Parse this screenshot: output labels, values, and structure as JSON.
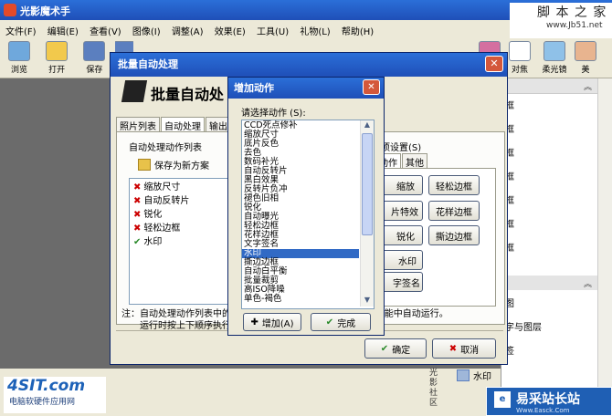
{
  "app": {
    "title": "光影魔术手",
    "watermark": "脚 本 之 家",
    "watermark_url": "www.Jb51.net",
    "menu": [
      "文件(F)",
      "编辑(E)",
      "查看(V)",
      "图像(I)",
      "调整(A)",
      "效果(E)",
      "工具(U)",
      "礼物(L)",
      "帮助(H)"
    ],
    "toolbar": [
      {
        "label": "浏览",
        "icon": "browse-icon"
      },
      {
        "label": "打开",
        "icon": "folder-icon"
      },
      {
        "label": "保存",
        "icon": "save-icon"
      },
      {
        "label": "另",
        "icon": "save-as-icon"
      }
    ],
    "toolbar_right": [
      {
        "label": "对焦",
        "icon": "focus-icon"
      },
      {
        "label": "柔光镜",
        "icon": "soft-light-icon"
      },
      {
        "label": "美",
        "icon": "beauty-icon"
      }
    ],
    "right_panel_items": [
      "框",
      "框",
      "框",
      "框",
      "框",
      "框",
      "框"
    ],
    "right_panel_lower": [
      "图",
      "字与图层",
      "签"
    ],
    "bottom_items": {
      "side_text": "光影社区",
      "watermark_item": "水印"
    }
  },
  "batch_dialog": {
    "title": "批量自动处理",
    "heading": "批量自动处",
    "tabs": [
      "照片列表",
      "自动处理",
      "输出"
    ],
    "list_title": "自动处理动作列表",
    "save_scheme": "保存为新方案",
    "actions": [
      {
        "label": "缩放尺寸",
        "checked": false
      },
      {
        "label": "自动反转片",
        "checked": false
      },
      {
        "label": "锐化",
        "checked": false
      },
      {
        "label": "轻松边框",
        "checked": false
      },
      {
        "label": "水印",
        "checked": true
      }
    ],
    "settings_title": "项设置(S)",
    "settings_tabs": [
      "动作",
      "其他"
    ],
    "right_buttons": [
      "缩放",
      "轻松边框",
      "片特效",
      "花样边框",
      "锐化",
      "撕边边框",
      "水印",
      "字签名"
    ],
    "note_line1": "注：自动处理动作列表中的",
    "note_line2": "运行时按上下顺序执行",
    "note_tail": "\" 功能中自动运行。",
    "ok": "确定",
    "cancel": "取消"
  },
  "add_dialog": {
    "title": "增加动作",
    "prompt": "请选择动作 (S):",
    "options": [
      "CCD死点修补",
      "缩放尺寸",
      "底片反色",
      "去色",
      "数码补光",
      "自动反转片",
      "黑白效果",
      "反转片负冲",
      "褪色旧相",
      "锐化",
      "自动曝光",
      "轻松边框",
      "花样边框",
      "文字签名",
      "水印",
      "撕边边框",
      "自动白平衡",
      "批量裁剪",
      "高ISO降噪",
      "单色-褐色"
    ],
    "selected": "水印",
    "add_button": "增加(A)",
    "done_button": "完成"
  },
  "logos": {
    "left_brand": "4SIT.com",
    "left_sub": "电脑软硬件应用网",
    "right_brand": "易采站长站",
    "right_sub": "Www.Easck.Com"
  }
}
